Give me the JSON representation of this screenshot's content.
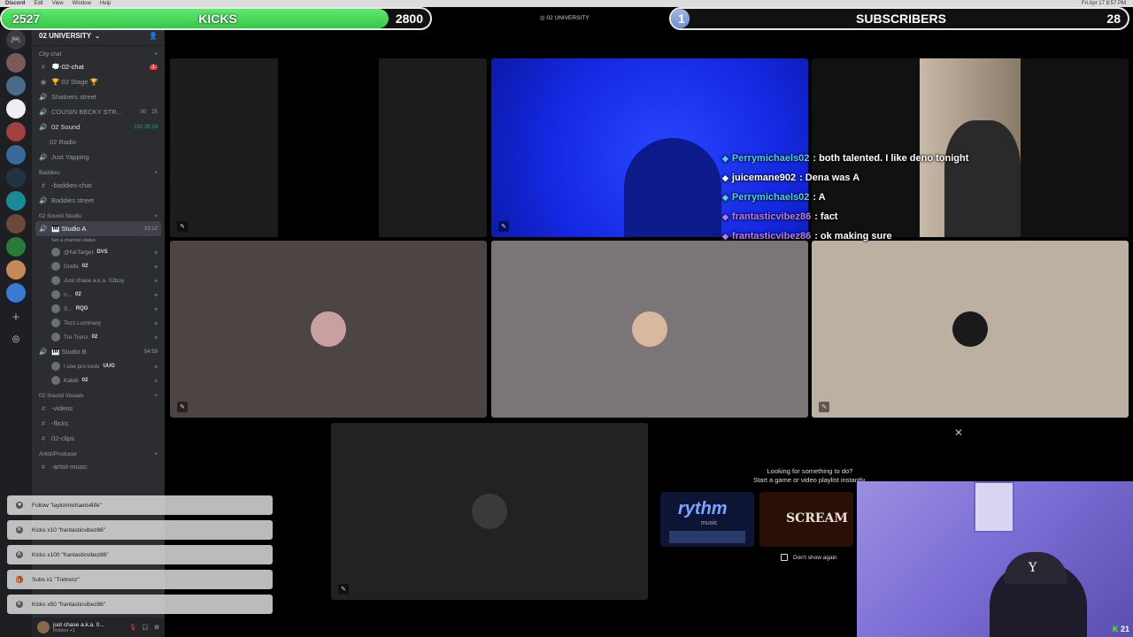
{
  "menubar": {
    "app": "Discord",
    "items": [
      "Edit",
      "View",
      "Window",
      "Help"
    ],
    "clock": "Fri Apr 17  8:57 PM"
  },
  "kicks": {
    "current": "2527",
    "label": "KICKS",
    "goal": "2800",
    "progress": 0.9025
  },
  "subs": {
    "current": "1",
    "label": "SUBSCRIBERS",
    "goal": "28",
    "progress": 0.036
  },
  "stage_title": "02 UNIVERSITY",
  "server": {
    "name": "02 UNIVERSITY"
  },
  "categories": {
    "city": "City chat",
    "baddies": "Baddies",
    "sound": "02 Sound Studio",
    "visuals": "02 Sound Visuals",
    "artist": "Artist/Producer"
  },
  "channels": {
    "chat": "💭-02-chat",
    "chat_badge": "1",
    "stage": "🏆 02 Stage 🏆",
    "shatners": "Shatners street",
    "cousin": "COUSIN BECKY STR...",
    "cousin_meta1": "00",
    "cousin_meta2": "25",
    "sound": "02 Sound",
    "sound_time": "191:39:19",
    "radio": "02 Radio",
    "yapping": "Just Yapping",
    "baddies_chat": "-baddies-chat",
    "baddies_street": "Baddies street",
    "studio_a": "🎹 Studio A",
    "studio_a_time": "33:12",
    "studio_a_status": "Set a channel status",
    "studio_b": "🎹 Studio B",
    "studio_b_time": "54:59",
    "videos": "-videos",
    "flicks": "-flicks",
    "clips": "02-clips",
    "artist_music": "-artist-music"
  },
  "studio_a_users": [
    {
      "name": "@fukTarget",
      "tag": "DVS"
    },
    {
      "name": "Drells",
      "tag": "02"
    },
    {
      "name": "Just chase a.k.a. 02boy",
      "tag": ""
    },
    {
      "name": "n...",
      "tag": "02"
    },
    {
      "name": "S...",
      "tag": "RQG"
    },
    {
      "name": "Tezz.Luminary",
      "tag": ""
    },
    {
      "name": "Tre Trenz",
      "tag": "02"
    }
  ],
  "studio_b_users": [
    {
      "name": "i use pro tools",
      "tag": "UUG"
    },
    {
      "name": "Kaleb",
      "tag": "02"
    }
  ],
  "notifications": [
    "Follow \"taylormichaels4life\"",
    "Kicks x10 \"frantasticvibez86\"",
    "Kicks x100 \"frantasticvibez86\"",
    "Subs x1 \"Tretrenz\"",
    "Kicks x50 \"frantasticvibez86\""
  ],
  "account": {
    "name": "just chase a.k.a. 0...",
    "status": "Roblox +1"
  },
  "chat": [
    {
      "user": "Perrymichaels02",
      "text": ": both talented. I like deno tonight",
      "color": "#4fd1e8"
    },
    {
      "user": "juicemane902",
      "text": ": Dena was A",
      "color": "#ffffff"
    },
    {
      "user": "Perrymichaels02",
      "text": ": A",
      "color": "#4fd1e8"
    },
    {
      "user": "frantasticvibez86",
      "text": ": fact",
      "color": "#b87cf0"
    },
    {
      "user": "frantasticvibez86",
      "text": ": ok making sure",
      "color": "#b87cf0"
    }
  ],
  "activity": {
    "line1": "Looking for something to do?",
    "line2": "Start a game or video playlist instantly.",
    "card1": "rythm",
    "card1_sub": "music",
    "card2": "SCREAM",
    "dont_show": "Don't show again"
  },
  "webcam": {
    "viewers": "21"
  },
  "colors": {
    "kick_green": "#53fc18",
    "discord_bg": "#2b2d31",
    "blue_tile": "#1a2df0"
  }
}
